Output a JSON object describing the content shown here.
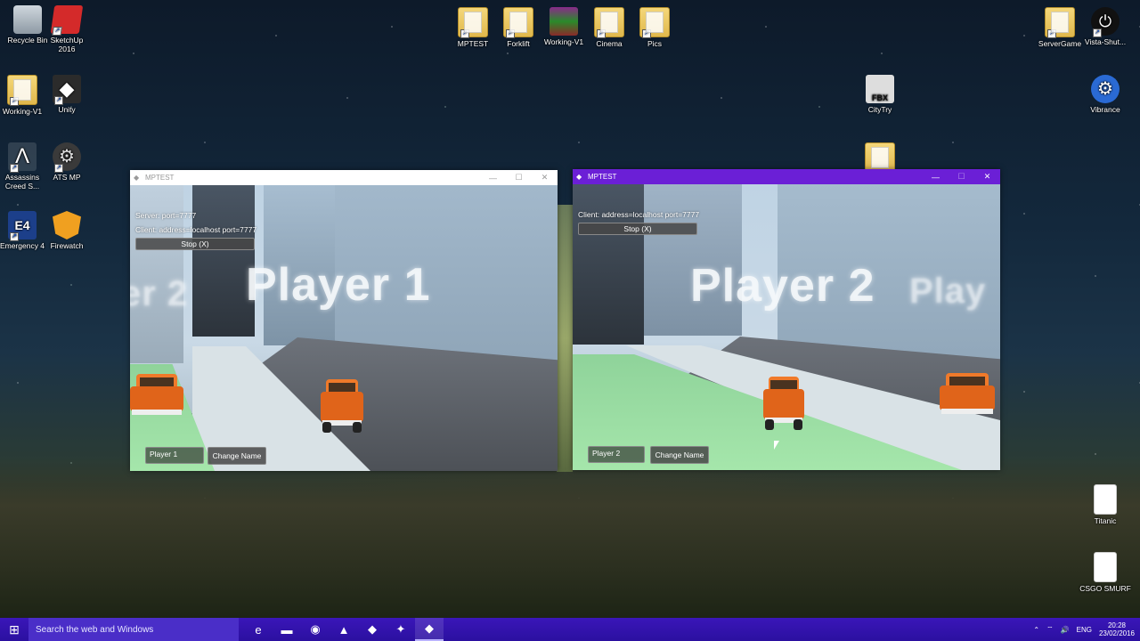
{
  "desktop_icons": [
    {
      "label": "Recycle Bin",
      "icon": "recycle-bin-icon"
    },
    {
      "label": "SketchUp 2016",
      "icon": "sketchup-icon"
    },
    {
      "label": "Working-V1",
      "icon": "folder-icon"
    },
    {
      "label": "Unity",
      "icon": "unity-icon"
    },
    {
      "label": "Assassins Creed S...",
      "icon": "assassins-creed-icon"
    },
    {
      "label": "ATS MP",
      "icon": "ats-mp-icon"
    },
    {
      "label": "Emergency 4",
      "icon": "emergency4-icon"
    },
    {
      "label": "Firewatch",
      "icon": "firewatch-icon"
    },
    {
      "label": "MPTEST",
      "icon": "folder-icon"
    },
    {
      "label": "Forklift",
      "icon": "folder-icon"
    },
    {
      "label": "Working-V1",
      "icon": "winrar-icon"
    },
    {
      "label": "Cinema",
      "icon": "folder-icon"
    },
    {
      "label": "Pics",
      "icon": "folder-icon"
    },
    {
      "label": "ServerGame",
      "icon": "folder-icon"
    },
    {
      "label": "Vista-Shut...",
      "icon": "vista-shutdown-icon"
    },
    {
      "label": "CityTry",
      "icon": "fbx-file-icon"
    },
    {
      "label": "Vibrance",
      "icon": "vibrance-icon"
    },
    {
      "label": "Titanic",
      "icon": "file-icon"
    },
    {
      "label": "CSGO SMURF",
      "icon": "file-icon"
    }
  ],
  "window1": {
    "title": "MPTEST",
    "server_text": "Server: port=7777",
    "client_text": "Client: address=localhost port=7777",
    "stop_label": "Stop (X)",
    "floating_text_main": "Player 1",
    "floating_text_side": "er 2",
    "name_field_value": "Player 1",
    "change_name_label": "Change Name"
  },
  "window2": {
    "title": "MPTEST",
    "client_text": "Client: address=localhost port=7777",
    "stop_label": "Stop (X)",
    "floating_text_main": "Player 2",
    "floating_text_side": "Play",
    "name_field_value": "Player 2",
    "change_name_label": "Change Name"
  },
  "taskbar": {
    "search_placeholder": "Search the web and Windows",
    "language": "ENG",
    "time": "20:28",
    "date": "23/02/2016"
  },
  "colors": {
    "taskbar": "#2b10a0",
    "window2_titlebar": "#6b1fd6",
    "car": "#e0641a",
    "grass": "#a5e6ab"
  }
}
